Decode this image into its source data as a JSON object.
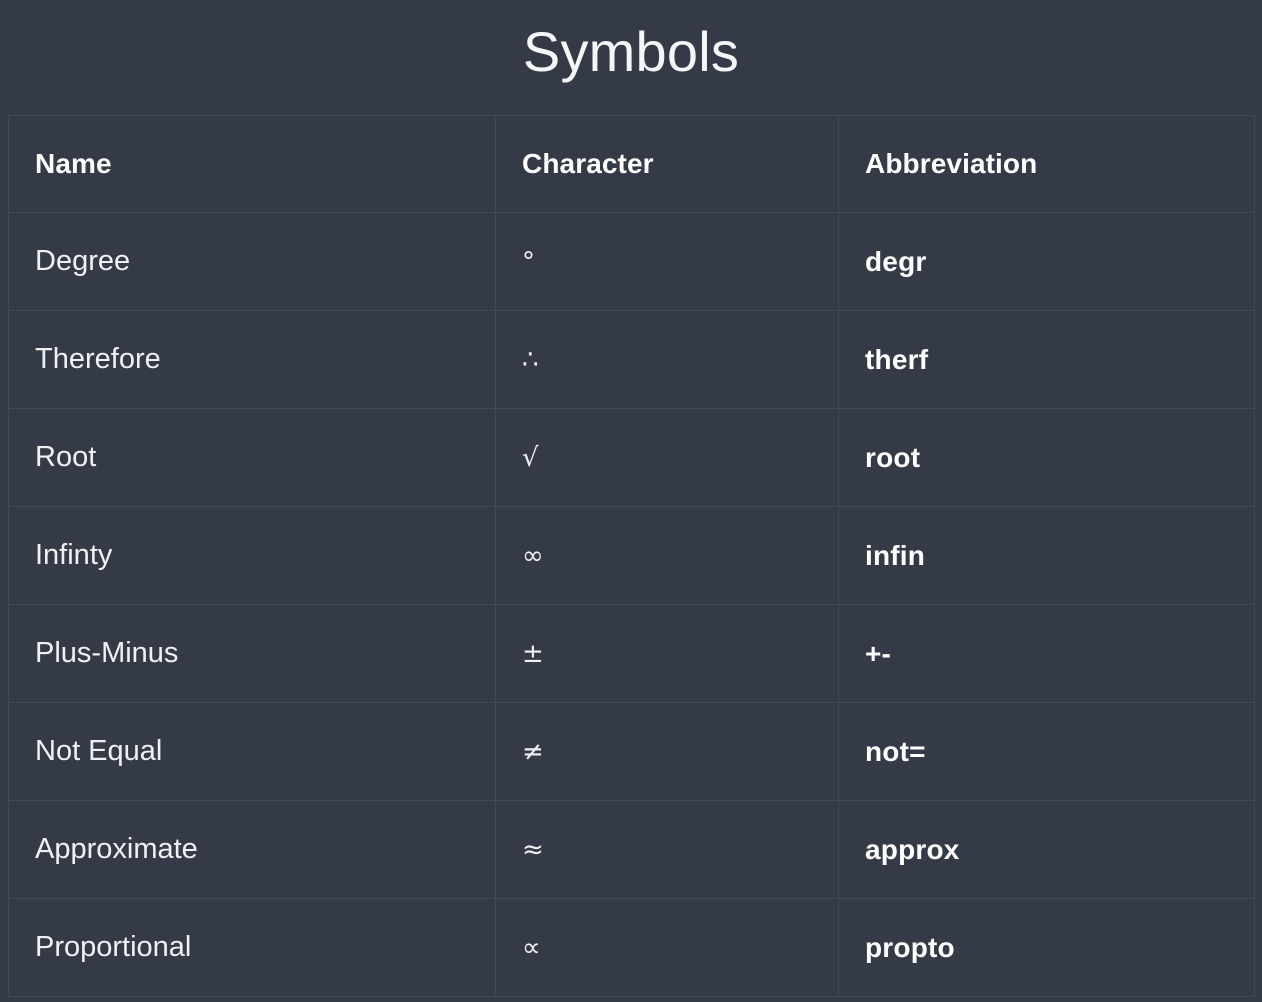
{
  "page": {
    "title": "Symbols",
    "background_color": "#343b46",
    "text_color": "#eef1f4",
    "border_color": "#414a57"
  },
  "table": {
    "columns": [
      {
        "key": "name",
        "header": "Name"
      },
      {
        "key": "character",
        "header": "Character"
      },
      {
        "key": "abbreviation",
        "header": "Abbreviation"
      }
    ],
    "rows": [
      {
        "name": "Degree",
        "character": "°",
        "abbreviation": "degr"
      },
      {
        "name": "Therefore",
        "character": "∴",
        "abbreviation": "therf"
      },
      {
        "name": "Root",
        "character": "√",
        "abbreviation": "root"
      },
      {
        "name": "Infinty",
        "character": "∞",
        "abbreviation": "infin"
      },
      {
        "name": "Plus-Minus",
        "character": "±",
        "abbreviation": "+-"
      },
      {
        "name": "Not Equal",
        "character": "≠",
        "abbreviation": "not="
      },
      {
        "name": "Approximate",
        "character": "≈",
        "abbreviation": "approx"
      },
      {
        "name": "Proportional",
        "character": "∝",
        "abbreviation": "propto"
      }
    ]
  }
}
